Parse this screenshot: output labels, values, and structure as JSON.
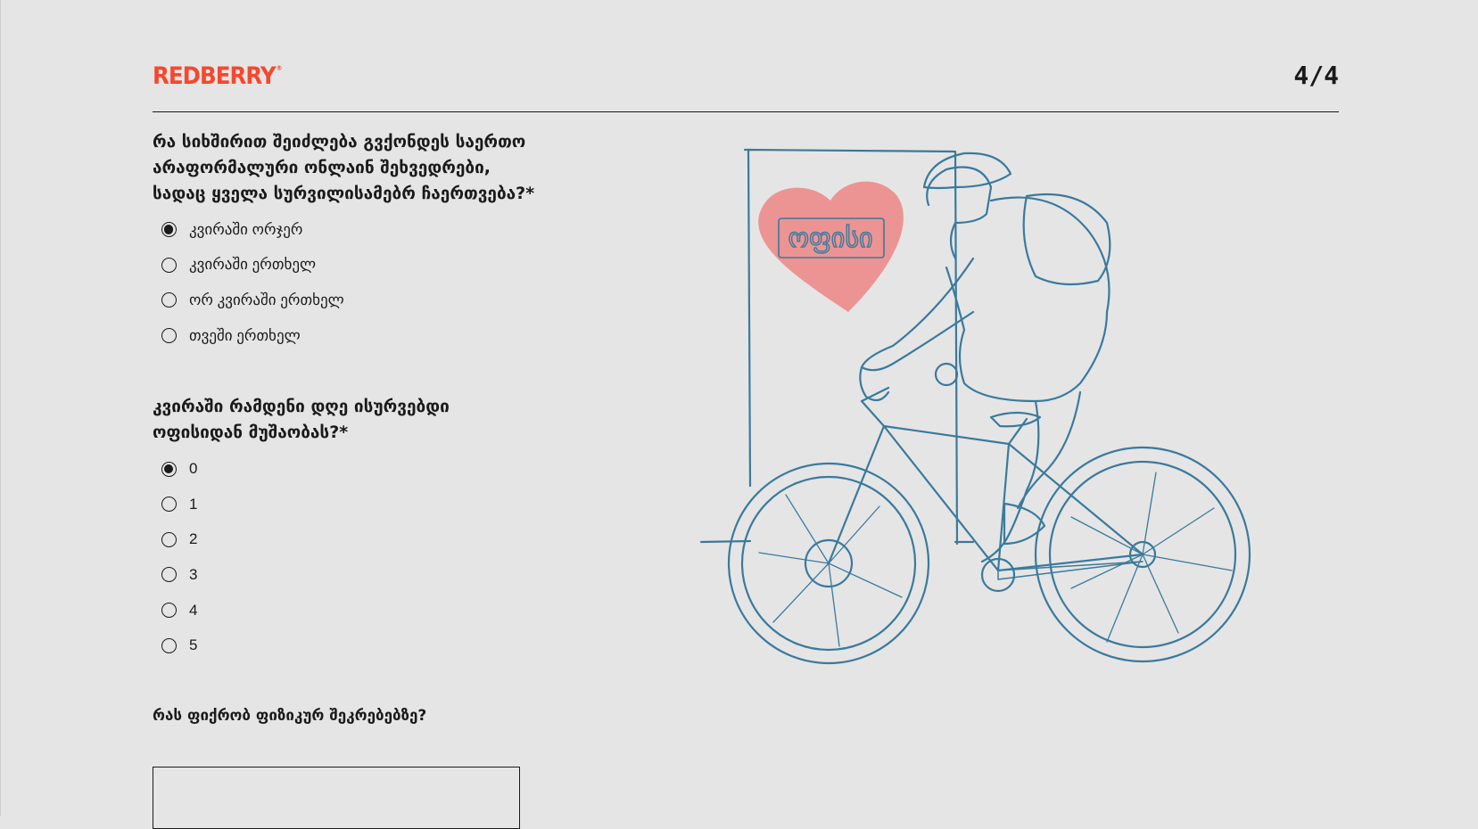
{
  "header": {
    "logo": "REDBERRY",
    "logo_mark": "®",
    "step": "4/4"
  },
  "question1": {
    "text": "რა სიხშირით შეიძლება გვქონდეს საერთო არაფორმალური ონლაინ შეხვედრები, სადაც ყველა სურვილისამებრ ჩაერთვება?*",
    "options": [
      {
        "label": "კვირაში ორჯერ",
        "checked": true
      },
      {
        "label": "კვირაში ერთხელ",
        "checked": false
      },
      {
        "label": "ორ კვირაში ერთხელ",
        "checked": false
      },
      {
        "label": "თვეში ერთხელ",
        "checked": false
      }
    ]
  },
  "question2": {
    "text": "კვირაში რამდენი დღე ისურვებდი ოფისიდან მუშაობას?*",
    "options": [
      {
        "label": "0",
        "checked": true
      },
      {
        "label": "1",
        "checked": false
      },
      {
        "label": "2",
        "checked": false
      },
      {
        "label": "3",
        "checked": false
      },
      {
        "label": "4",
        "checked": false
      },
      {
        "label": "5",
        "checked": false
      }
    ]
  },
  "question3": {
    "text": "რას ფიქრობ ფიზიკურ შეკრებებზე?",
    "value": ""
  },
  "illustration": {
    "sign_text": "ოფისი",
    "colors": {
      "line": "#3a7a9c",
      "heart": "#ec8f8f",
      "accent": "#f3492f"
    }
  }
}
